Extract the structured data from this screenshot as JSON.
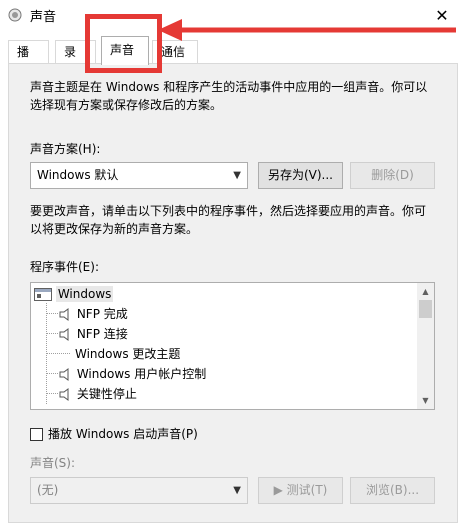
{
  "window": {
    "title": "声音",
    "close_glyph": "✕"
  },
  "tabs": [
    {
      "label": "播放"
    },
    {
      "label": "录制"
    },
    {
      "label": "声音"
    },
    {
      "label": "通信"
    }
  ],
  "description": {
    "line1": "声音主题是在 Windows 和程序产生的活动事件中应用的一组声音。你可以",
    "line2": "选择现有方案或保存修改后的方案。"
  },
  "scheme": {
    "label": "声音方案(H):",
    "value": "Windows 默认",
    "save_as": "另存为(V)...",
    "delete": "删除(D)"
  },
  "instructions": {
    "line1": "要更改声音，请单击以下列表中的程序事件，然后选择要应用的声音。你可",
    "line2": "以将更改保存为新的声音方案。"
  },
  "events": {
    "label": "程序事件(E):",
    "items": [
      {
        "label": "Windows",
        "icon": "window-icon"
      },
      {
        "label": "NFP 完成",
        "icon": "speaker-icon"
      },
      {
        "label": "NFP 连接",
        "icon": "speaker-icon"
      },
      {
        "label": "Windows 更改主题",
        "icon": ""
      },
      {
        "label": "Windows 用户帐户控制",
        "icon": "speaker-icon"
      },
      {
        "label": "关键性停止",
        "icon": "speaker-icon"
      }
    ]
  },
  "startup": {
    "label": "播放 Windows 启动声音(P)"
  },
  "sound": {
    "label": "声音(S):",
    "value": "(无)",
    "test": "▶ 测试(T)",
    "browse": "浏览(B)..."
  },
  "colors": {
    "annotation_red": "#e53935"
  }
}
